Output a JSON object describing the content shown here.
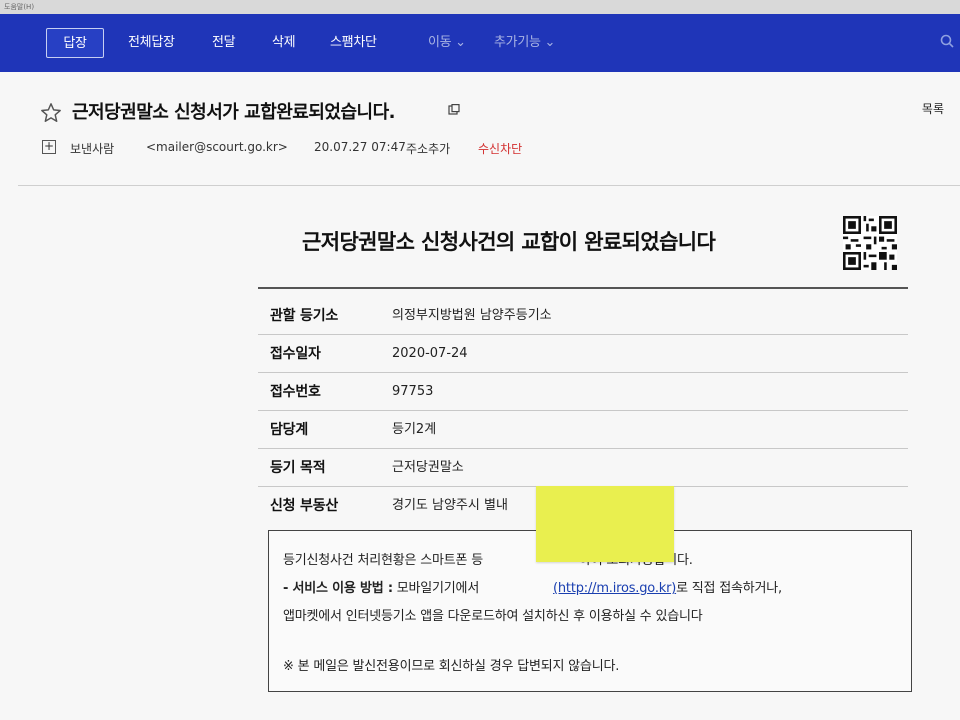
{
  "window": {
    "title_strip": "도움말(H)"
  },
  "toolbar": {
    "reply": "답장",
    "reply_all": "전체답장",
    "forward": "전달",
    "delete": "삭제",
    "spam_block": "스팸차단",
    "move": "이동 ⌄",
    "more": "추가기능 ⌄"
  },
  "mail": {
    "subject": "근저당권말소 신청서가 교합완료되었습니다.",
    "list_link": "목록",
    "sender_label": "보낸사람",
    "sender_email": "<mailer@scourt.go.kr>",
    "date": "20.07.27 07:47",
    "add_contact": "주소추가",
    "block_receive": "수신차단"
  },
  "content": {
    "title": "근저당권말소 신청사건의 교합이 완료되었습니다",
    "rows": [
      {
        "label": "관할 등기소",
        "value": "의정부지방법원 남양주등기소"
      },
      {
        "label": "접수일자",
        "value": "2020-07-24"
      },
      {
        "label": "접수번호",
        "value": "97753"
      },
      {
        "label": "담당계",
        "value": "등기2계"
      },
      {
        "label": "등기 목적",
        "value": "근저당권말소"
      },
      {
        "label": "신청 부동산",
        "value": "경기도 남양주시 별내"
      }
    ],
    "notice": {
      "line1_start": "등기신청사건 처리현황은 스마트폰 등",
      "line1_end": "하여 조회가능합니다.",
      "service_label": "- 서비스 이용 방법 :",
      "line2_start": " 모바일기기에서 ",
      "link_text": "(http://m.iros.go.kr)",
      "line2_end": "로 직접 접속하거나,",
      "line3": "앱마켓에서 인터넷등기소 앱을 다운로드하여 설치하신 후 이용하실 수 있습니다",
      "line4": "※ 본 메일은 발신전용이므로 회신하실 경우 답변되지 않습니다."
    }
  },
  "colors": {
    "toolbar_bg": "#1f35b8",
    "block_link": "#d32f2f",
    "sticky_note": "#e9ef4f"
  }
}
